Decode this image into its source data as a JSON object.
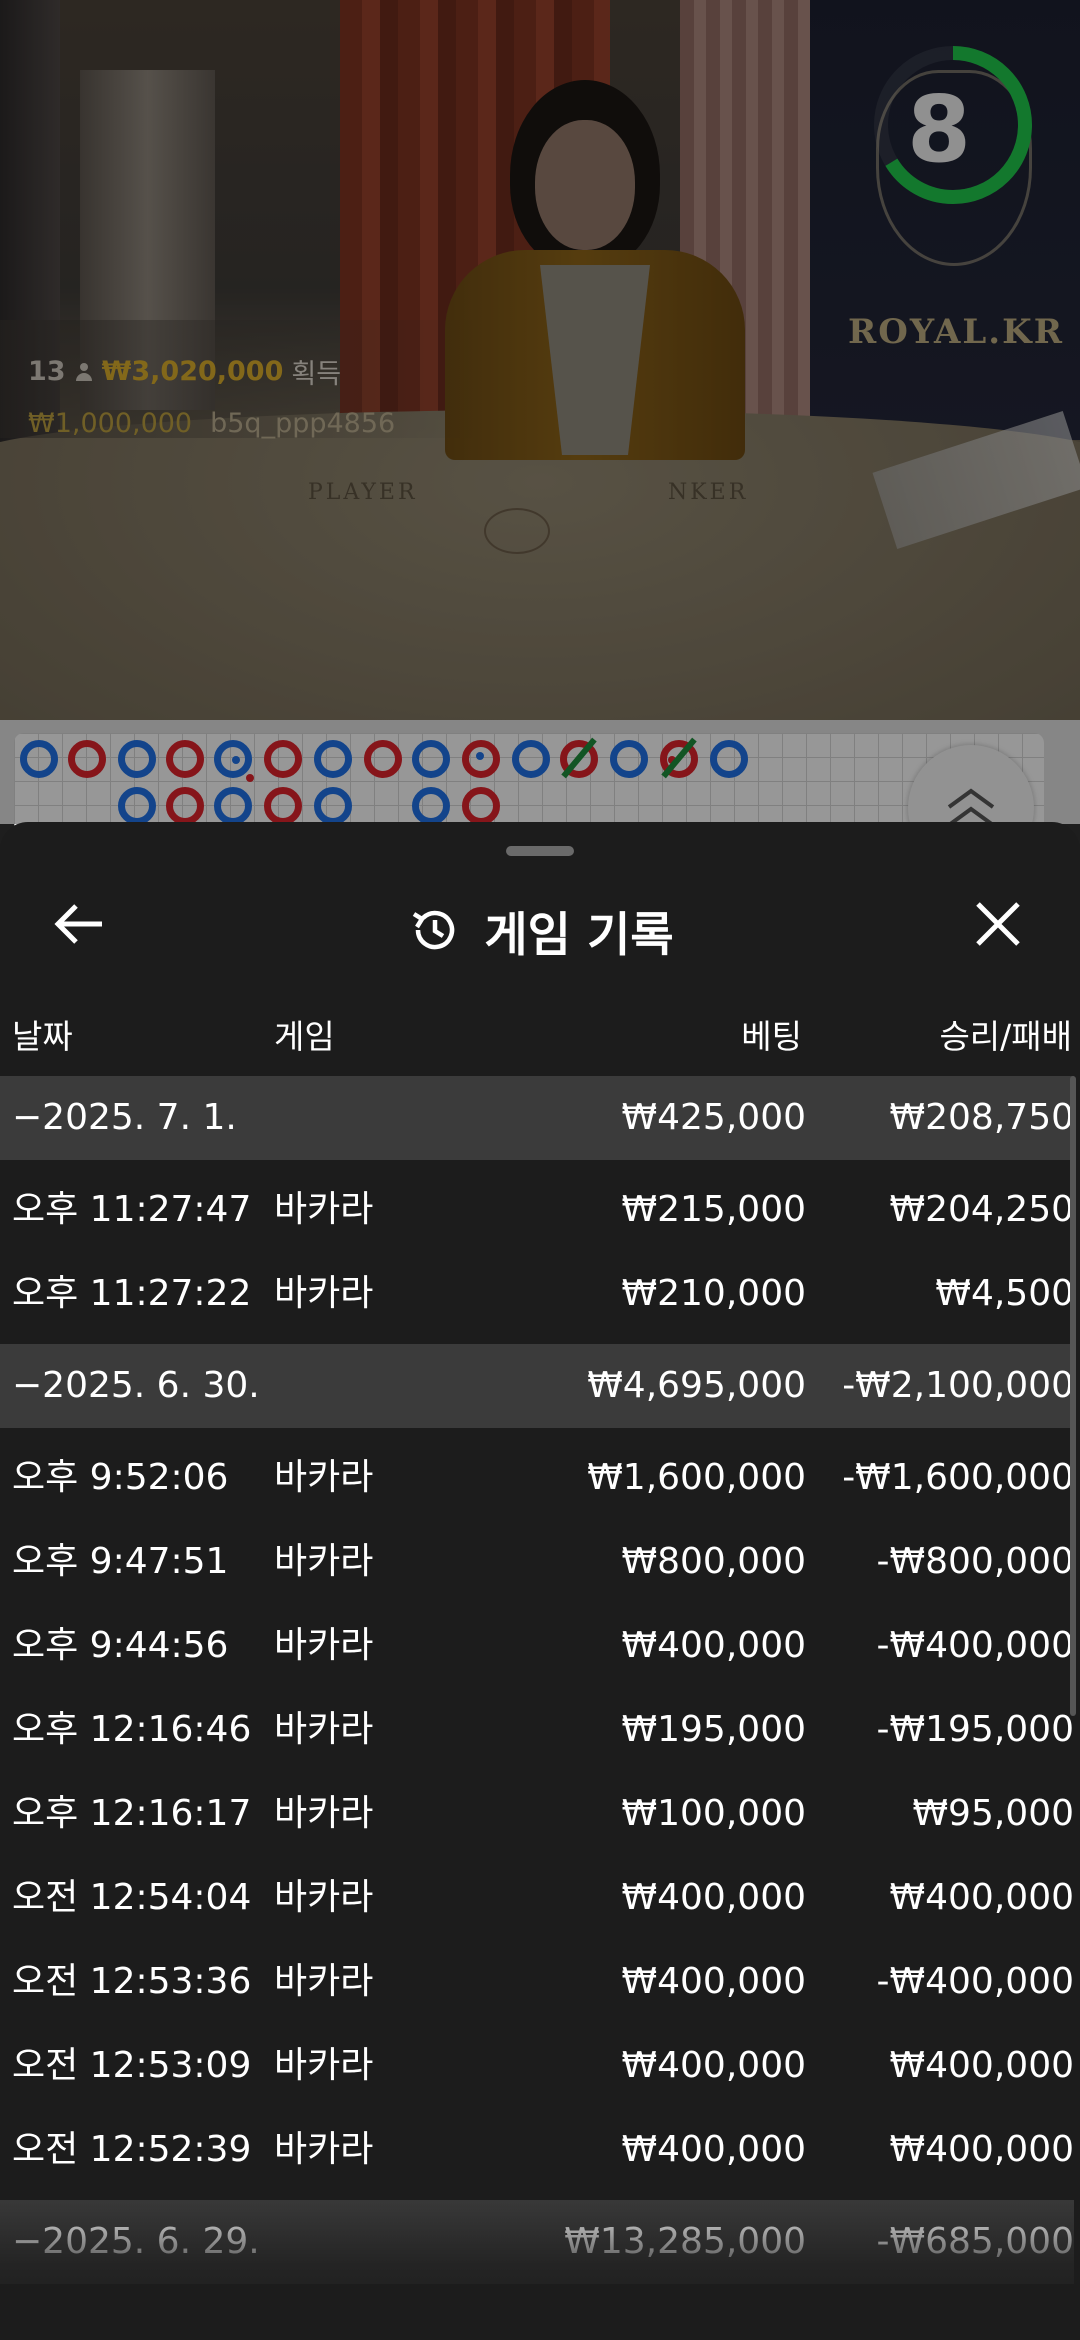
{
  "video": {
    "timer_value": "8",
    "brand_text": "ROYAL.KR",
    "felt_player": "PLAYER",
    "felt_banker": "NKER",
    "win_notice": {
      "count": "13",
      "amount": "₩3,020,000",
      "suffix": "획득"
    },
    "bet_notice": {
      "amount": "₩1,000,000",
      "user": "b5q_ppp4856"
    },
    "timer_color": "#1fc24a"
  },
  "roadmap": {
    "blue": "#1f6fe0",
    "red": "#d8222a",
    "tie_color": "#1d8a3a"
  },
  "sheet": {
    "title": "게임 기록",
    "back_icon": "arrow-left-icon",
    "history_icon": "history-clock-icon",
    "close_icon": "close-x-icon",
    "columns": {
      "date": "날짜",
      "game": "게임",
      "bet": "베팅",
      "result": "승리/패배"
    },
    "groups": [
      {
        "date": "−2025. 7. 1.",
        "bet": "₩425,000",
        "result": "₩208,750",
        "rows": [
          {
            "time": "오후 11:27:47",
            "game": "바카라",
            "bet": "₩215,000",
            "result": "₩204,250"
          },
          {
            "time": "오후 11:27:22",
            "game": "바카라",
            "bet": "₩210,000",
            "result": "₩4,500"
          }
        ]
      },
      {
        "date": "−2025. 6. 30.",
        "bet": "₩4,695,000",
        "result": "-₩2,100,000",
        "rows": [
          {
            "time": "오후 9:52:06",
            "game": "바카라",
            "bet": "₩1,600,000",
            "result": "-₩1,600,000"
          },
          {
            "time": "오후 9:47:51",
            "game": "바카라",
            "bet": "₩800,000",
            "result": "-₩800,000"
          },
          {
            "time": "오후 9:44:56",
            "game": "바카라",
            "bet": "₩400,000",
            "result": "-₩400,000"
          },
          {
            "time": "오후 12:16:46",
            "game": "바카라",
            "bet": "₩195,000",
            "result": "-₩195,000"
          },
          {
            "time": "오후 12:16:17",
            "game": "바카라",
            "bet": "₩100,000",
            "result": "₩95,000"
          },
          {
            "time": "오전 12:54:04",
            "game": "바카라",
            "bet": "₩400,000",
            "result": "₩400,000"
          },
          {
            "time": "오전 12:53:36",
            "game": "바카라",
            "bet": "₩400,000",
            "result": "-₩400,000"
          },
          {
            "time": "오전 12:53:09",
            "game": "바카라",
            "bet": "₩400,000",
            "result": "₩400,000"
          },
          {
            "time": "오전 12:52:39",
            "game": "바카라",
            "bet": "₩400,000",
            "result": "₩400,000"
          }
        ]
      },
      {
        "date": "−2025. 6. 29.",
        "bet": "₩13,285,000",
        "result": "-₩685,000",
        "rows": []
      }
    ]
  }
}
